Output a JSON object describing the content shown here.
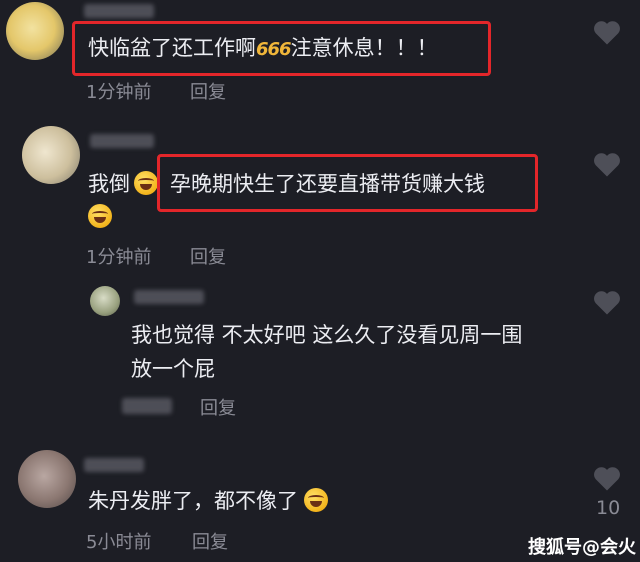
{
  "comments": [
    {
      "text_parts": [
        "快临盆了还工作啊",
        "注意休息！！！"
      ],
      "emoji_inline": "666",
      "time": "1分钟前",
      "reply_label": "回复"
    },
    {
      "prefix": "我倒",
      "highlight": "孕晚期快生了还要直播带货赚大钱",
      "time": "1分钟前",
      "reply_label": "回复"
    },
    {
      "line1": "我也觉得 不太好吧 这么久了没看见周一围",
      "line2": "放一个屁",
      "reply_label": "回复"
    },
    {
      "text": "朱丹发胖了，都不像了",
      "time": "5小时前",
      "reply_label": "回复",
      "like_count": "10"
    }
  ],
  "watermark": "搜狐号@会火",
  "colors": {
    "background": "#1d1e25",
    "highlight_border": "#e3262a",
    "meta_text": "#8a8b95"
  },
  "icons": [
    "heart-icon",
    "laughing-crying-emoji-icon"
  ]
}
